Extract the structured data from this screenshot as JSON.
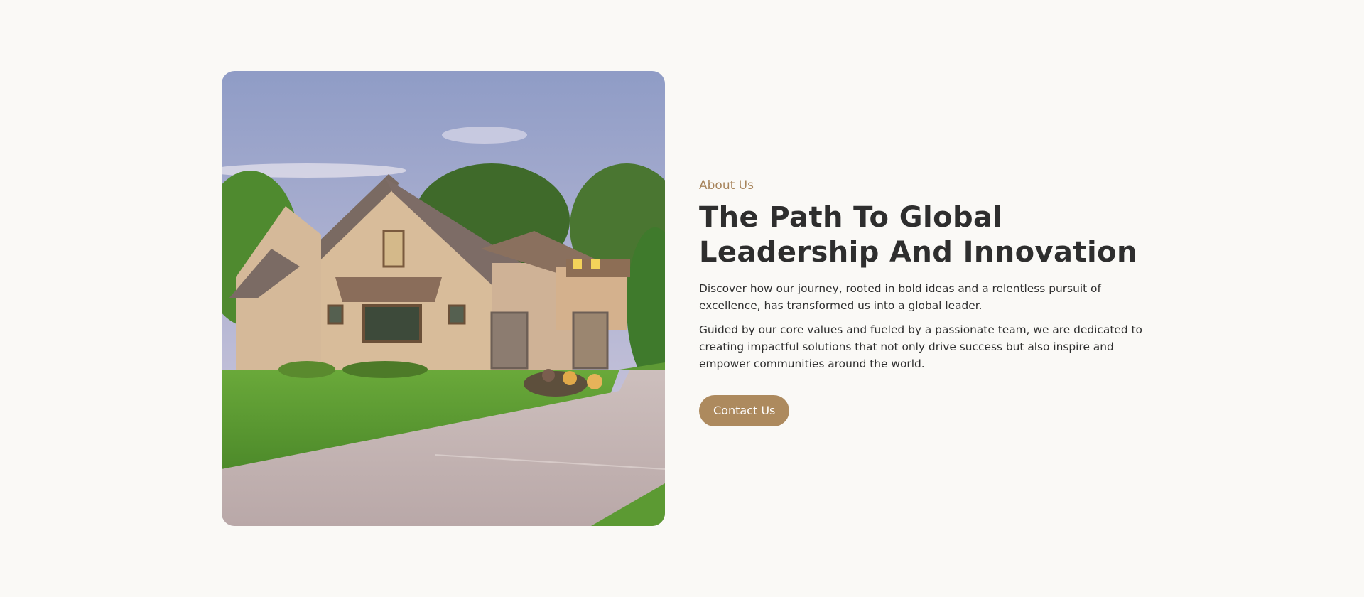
{
  "about": {
    "eyebrow": "About Us",
    "heading_line1": "The Path To Global",
    "heading_line2": "Leadership And Innovation",
    "paragraph1": "Discover how our journey, rooted in bold ideas and a relentless pursuit of excellence, has transformed us into a global leader.",
    "paragraph2": "Guided by our core values and fueled by a passionate team, we are dedicated to creating impactful solutions that not only drive success but also inspire and empower communities around the world.",
    "button_label": "Contact Us"
  },
  "colors": {
    "background": "#faf9f6",
    "accent": "#ad8a5e",
    "eyebrow": "#a8855c",
    "heading": "#2e2e2e",
    "body_text": "#2f2f2f"
  },
  "image": {
    "subject": "house-photo"
  }
}
